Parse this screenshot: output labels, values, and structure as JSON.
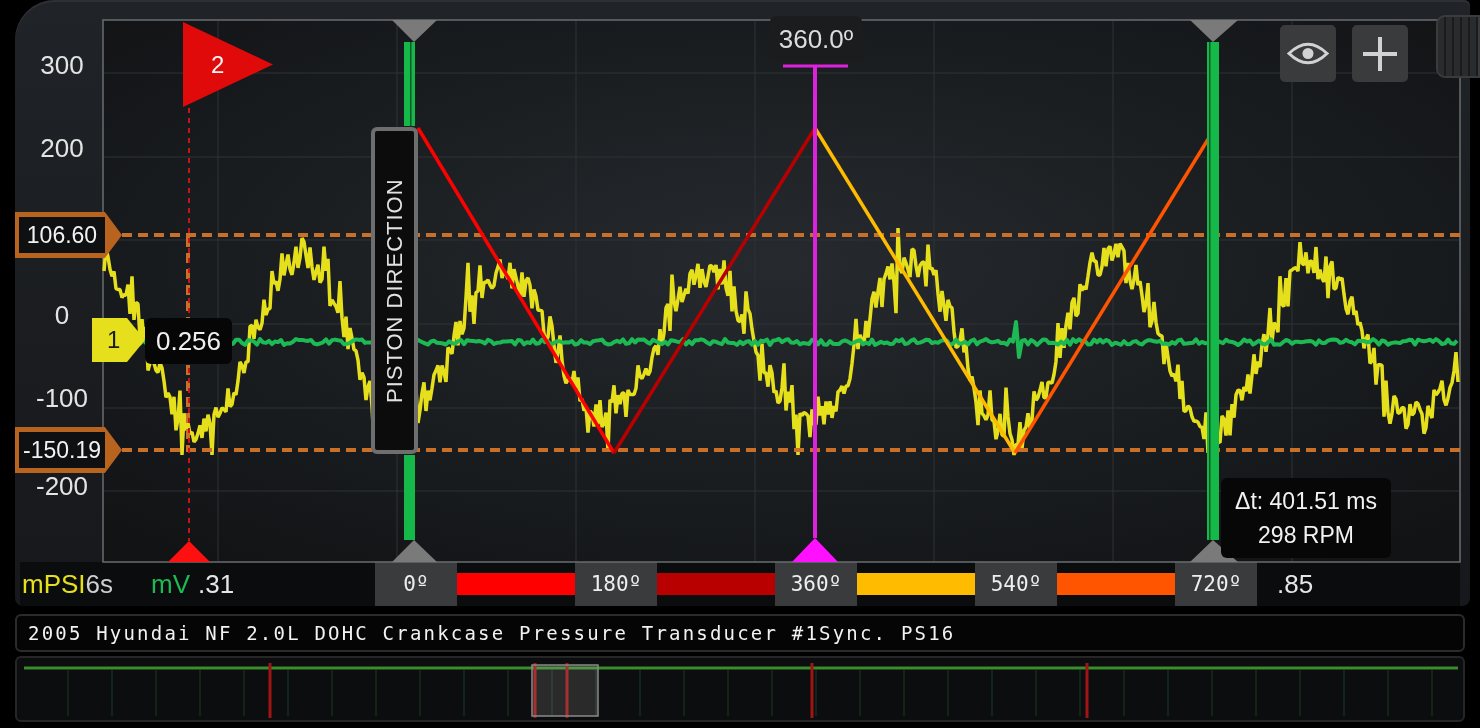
{
  "y_axis": {
    "labels": [
      "300",
      "200",
      "0",
      "-100",
      "-200"
    ]
  },
  "reference_levels": [
    {
      "label": "106.60"
    },
    {
      "label": "-150.19"
    }
  ],
  "channels": [
    {
      "unit": "mPSI",
      "color": "#e6e01c"
    },
    {
      "unit": "mV",
      "color": "#1db954"
    }
  ],
  "channel_marker": {
    "number": "1",
    "reading": "0.256"
  },
  "flag_marker": {
    "number": "2"
  },
  "piston_direction": {
    "label": "PISTON DIRECTION"
  },
  "angle_cursor": {
    "reading": "360.0º"
  },
  "timing_readout": {
    "lines": [
      "Δt: 401.51 ms",
      "298 RPM"
    ]
  },
  "x_axis": {
    "labels": [
      "6s",
      ".31",
      ".85"
    ]
  },
  "crank_angle_scale": {
    "labels": [
      "0º",
      "180º",
      "360º",
      "540º",
      "720º"
    ],
    "bands": [
      {
        "color": "#ff0000"
      },
      {
        "color": "#b80000"
      },
      {
        "color": "#ffbb00"
      },
      {
        "color": "#ff5500"
      }
    ]
  },
  "trace_title": "2005 Hyundai NF 2.0L DOHC Crankcase Pressure Transducer #1Sync. PS16"
}
